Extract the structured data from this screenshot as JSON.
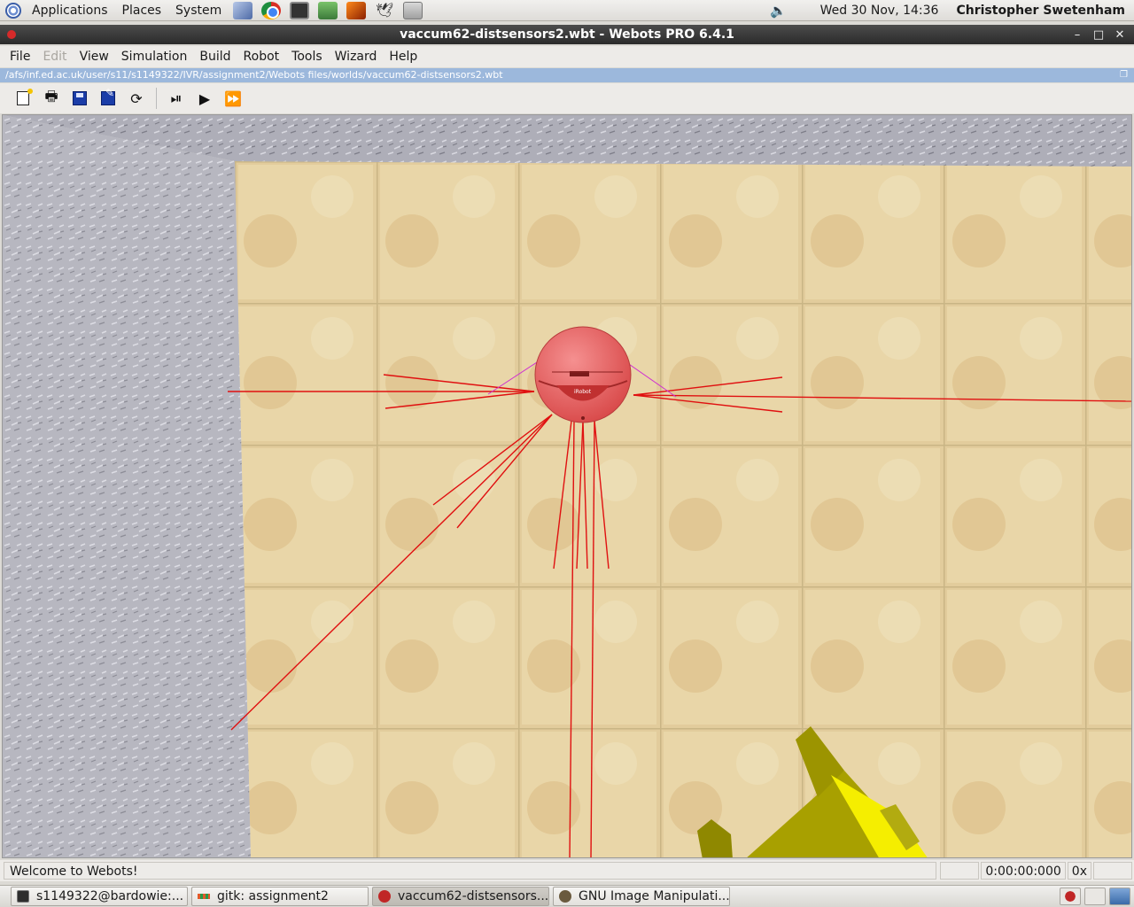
{
  "top_panel": {
    "menus": [
      "Applications",
      "Places",
      "System"
    ],
    "launchers": [
      "cube-icon",
      "chrome-icon",
      "terminal-icon",
      "puzzle-icon",
      "matlab-icon",
      "bird-icon",
      "device-icon"
    ],
    "clock": "Wed 30 Nov, 14:36",
    "user": "Christopher Swetenham"
  },
  "window": {
    "title": "vaccum62-distsensors2.wbt - Webots PRO 6.4.1"
  },
  "menubar": {
    "items": [
      {
        "label": "File",
        "enabled": true
      },
      {
        "label": "Edit",
        "enabled": false
      },
      {
        "label": "View",
        "enabled": true
      },
      {
        "label": "Simulation",
        "enabled": true
      },
      {
        "label": "Build",
        "enabled": true
      },
      {
        "label": "Robot",
        "enabled": true
      },
      {
        "label": "Tools",
        "enabled": true
      },
      {
        "label": "Wizard",
        "enabled": true
      },
      {
        "label": "Help",
        "enabled": true
      }
    ]
  },
  "pathbar": {
    "path": "/afs/inf.ed.ac.uk/user/s11/s1149322/IVR/assignment2/Webots files/worlds/vaccum62-distsensors2.wbt"
  },
  "toolbar": {
    "buttons": [
      "new-world-icon",
      "open-icon",
      "save-icon",
      "save-as-icon",
      "revert-icon",
      "step-icon",
      "run-icon",
      "fast-icon"
    ]
  },
  "viewport": {
    "robot_color": "#e86060",
    "sensor_ray_color": "#e01010",
    "wall_color": "#a9a9b2",
    "floor_color": "#e0c99a",
    "obstacle_color": "#a8a000"
  },
  "statusbar": {
    "message": "Welcome to Webots!",
    "time": "0:00:00:000",
    "speed": "0x"
  },
  "taskbar": {
    "tasks": [
      {
        "label": "s1149322@bardowie:...",
        "icon": "terminal-icon",
        "active": false
      },
      {
        "label": "gitk: assignment2",
        "icon": "gitk-icon",
        "active": false
      },
      {
        "label": "vaccum62-distsensors...",
        "icon": "webots-icon",
        "active": true
      },
      {
        "label": "GNU Image Manipulati...",
        "icon": "gimp-icon",
        "active": false
      }
    ]
  }
}
